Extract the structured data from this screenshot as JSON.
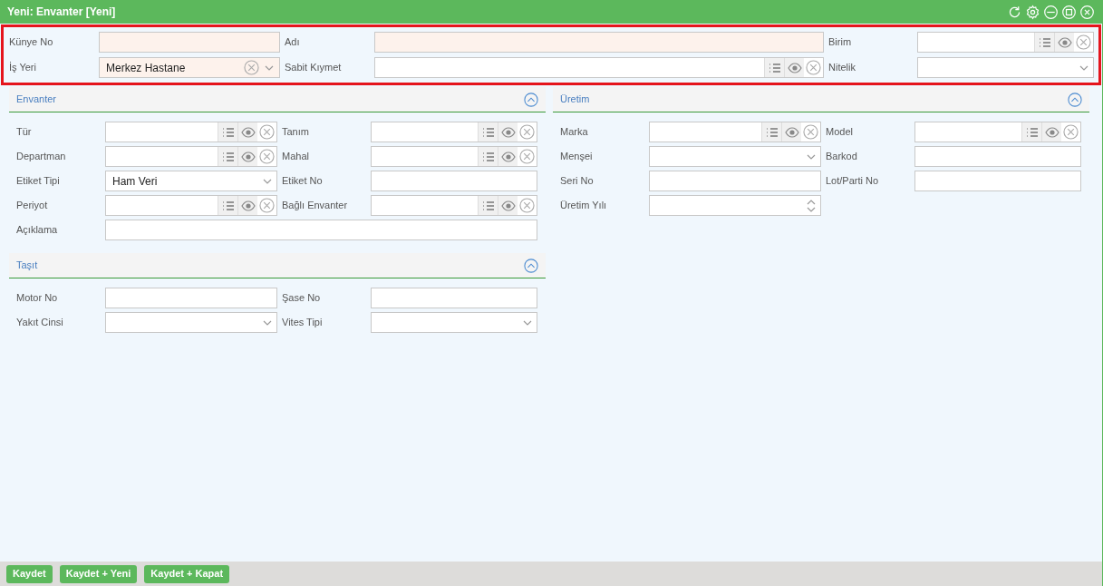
{
  "window": {
    "title": "Yeni: Envanter [Yeni]"
  },
  "header_fields": [
    {
      "label": "Künye No",
      "kind": "text",
      "required": true
    },
    {
      "label": "Adı",
      "kind": "text",
      "required": true
    },
    {
      "label": "Birim",
      "kind": "lookup",
      "required": false
    },
    {
      "label": "İş Yeri",
      "kind": "combo",
      "required": true,
      "value": "Merkez Hastane"
    },
    {
      "label": "Sabit Kıymet",
      "kind": "lookup",
      "required": false
    },
    {
      "label": "Nitelik",
      "kind": "select",
      "required": false
    }
  ],
  "sections": [
    {
      "title": "Envanter",
      "expanded": true,
      "fields": [
        {
          "label": "Tür",
          "kind": "lookup"
        },
        {
          "label": "Tanım",
          "kind": "lookup"
        },
        {
          "label": "Departman",
          "kind": "lookup"
        },
        {
          "label": "Mahal",
          "kind": "lookup"
        },
        {
          "label": "Etiket Tipi",
          "kind": "select",
          "value": "Ham Veri"
        },
        {
          "label": "Etiket No",
          "kind": "text"
        },
        {
          "label": "Periyot",
          "kind": "lookup"
        },
        {
          "label": "Bağlı Envanter",
          "kind": "lookup"
        },
        {
          "label": "Açıklama",
          "kind": "wide"
        }
      ]
    },
    {
      "title": "Taşıt",
      "expanded": true,
      "fields": [
        {
          "label": "Motor No",
          "kind": "text"
        },
        {
          "label": "Şase No",
          "kind": "text"
        },
        {
          "label": "Yakıt Cinsi",
          "kind": "select"
        },
        {
          "label": "Vites Tipi",
          "kind": "select"
        }
      ]
    },
    {
      "title": "Üretim",
      "expanded": true,
      "fields": [
        {
          "label": "Marka",
          "kind": "lookup"
        },
        {
          "label": "Model",
          "kind": "lookup"
        },
        {
          "label": "Menşei",
          "kind": "select"
        },
        {
          "label": "Barkod",
          "kind": "text"
        },
        {
          "label": "Seri No",
          "kind": "text"
        },
        {
          "label": "Lot/Parti No",
          "kind": "text"
        },
        {
          "label": "Üretim Yılı",
          "kind": "spinner"
        }
      ]
    }
  ],
  "buttons": [
    "Kaydet",
    "Kaydet + Yeni",
    "Kaydet + Kapat"
  ]
}
